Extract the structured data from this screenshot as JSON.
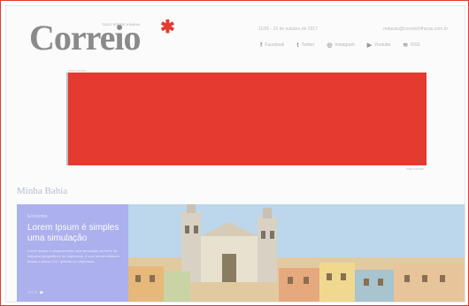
{
  "header": {
    "logo_text": "Correio",
    "logo_tagline": "TUDO SOBRE A BAHIA",
    "date_info": "11/26 - 22 de outubro de 2017",
    "email": "redacao@correio24horas.com.br",
    "social": [
      {
        "icon": "facebook-icon",
        "glyph": "f",
        "label": "Facebook"
      },
      {
        "icon": "twitter-icon",
        "glyph": "t",
        "label": "Twitter"
      },
      {
        "icon": "instagram-icon",
        "glyph": "◎",
        "label": "Instagram"
      },
      {
        "icon": "youtube-icon",
        "glyph": "▶",
        "label": "Youtube"
      },
      {
        "icon": "rss-icon",
        "glyph": "≋",
        "label": "RSS"
      }
    ]
  },
  "ad": {
    "label": "PUBLICIDADE",
    "footer": "PUBLICIDADE",
    "color": "#e43a2f"
  },
  "section": {
    "title": "Minha Bahia"
  },
  "hero": {
    "category": "Economia",
    "title": "Lorem Ipsum é simples uma simulação",
    "description": "Lorem Ipsum é simplesmente uma simulação de texto da indústria tipográfica e de impressos, e vem sendo utilizado desde o século XVI, quando um impressor.",
    "pager": "○○○ ▶",
    "panel_color": "#a9aef0"
  }
}
